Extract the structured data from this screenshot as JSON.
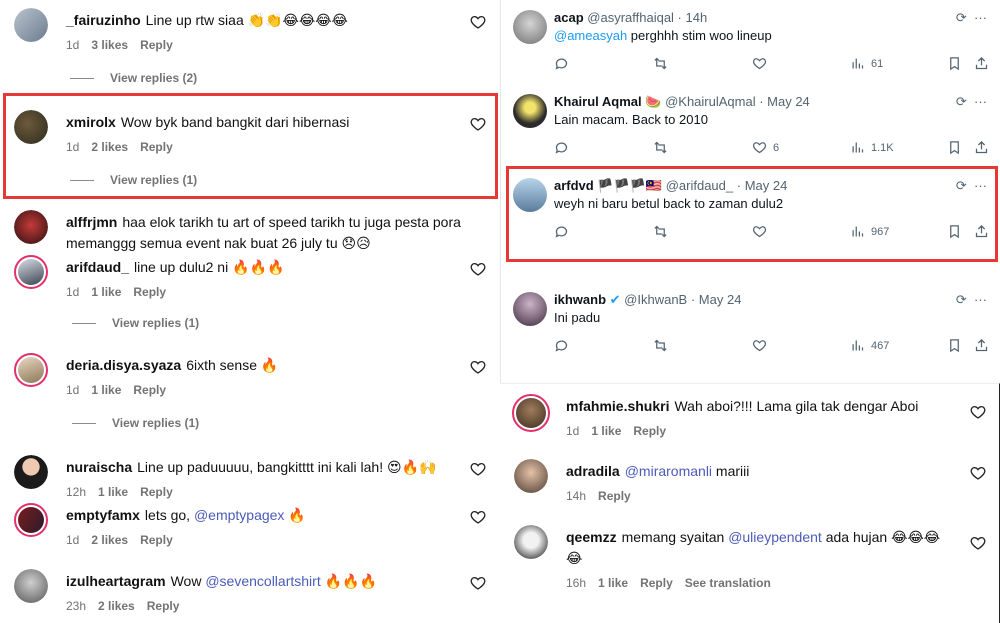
{
  "ig_left": [
    {
      "user": "_fairuzinho",
      "text": "Line up rtw siaa 👏👏😂😂😂😂",
      "time": "1d",
      "likes": "3 likes",
      "reply": "Reply",
      "replies": "View replies (2)"
    },
    {
      "user": "xmirolx",
      "text": "Wow byk band bangkit dari hibernasi",
      "time": "1d",
      "likes": "2 likes",
      "reply": "Reply",
      "replies": "View replies (1)"
    },
    {
      "user": "alffrjmn",
      "text": "haa elok tarikh tu art of speed tarikh tu juga pesta pora memanggg semua event nak buat 26 july tu 😞😥"
    },
    {
      "user": "arifdaud_",
      "text": "line up dulu2 ni 🔥🔥🔥",
      "time": "1d",
      "likes": "1 like",
      "reply": "Reply",
      "replies": "View replies (1)"
    },
    {
      "user": "deria.disya.syaza",
      "text": "6ixth sense 🔥",
      "time": "1d",
      "likes": "1 like",
      "reply": "Reply",
      "replies": "View replies (1)"
    },
    {
      "user": "nuraischa",
      "text": "Line up paduuuuu, bangkitttt ini kali lah! 😍🔥🙌",
      "time": "12h",
      "likes": "1 like",
      "reply": "Reply"
    },
    {
      "user": "emptyfamx",
      "text_before": "lets go, ",
      "mention": "@emptypagex",
      "text_after": " 🔥",
      "time": "1d",
      "likes": "2 likes",
      "reply": "Reply"
    },
    {
      "user": "izulheartagram",
      "text_before": "Wow ",
      "mention": "@sevencollartshirt",
      "text_after": " 🔥🔥🔥",
      "time": "23h",
      "likes": "2 likes",
      "reply": "Reply"
    }
  ],
  "tweets": [
    {
      "name": "acap",
      "handle": "@asyraffhaiqal",
      "time": "14h",
      "mention": "@ameasyah",
      "text": " perghhh stim woo lineup",
      "like": "",
      "retweet": "",
      "views": "61"
    },
    {
      "name": "Khairul Aqmal 🍉",
      "handle": "@KhairulAqmal",
      "time": "May 24",
      "text": "Lain macam. Back to 2010",
      "like": "6",
      "retweet": "",
      "views": "1.1K"
    },
    {
      "name": "arfdvd 🏴🏴🏴🇲🇾",
      "handle": "@arifdaud_",
      "time": "May 24",
      "text": "weyh ni baru betul back to zaman dulu2",
      "like": "",
      "retweet": "",
      "views": "967"
    },
    {
      "name": "ikhwanb",
      "handle": "@IkhwanB",
      "time": "May 24",
      "text": "Ini padu",
      "like": "",
      "retweet": "",
      "views": "467"
    }
  ],
  "ig_right": [
    {
      "user": "mfahmie.shukri",
      "text": "Wah aboi?!!! Lama gila tak dengar Aboi",
      "time": "1d",
      "likes": "1 like",
      "reply": "Reply"
    },
    {
      "user": "adradila",
      "mention": "@miraromanli",
      "text_after": " mariii",
      "time": "14h",
      "reply": "Reply"
    },
    {
      "user": "qeemzz",
      "text_before": "memang syaitan ",
      "mention": "@ulieypendent",
      "text_after": " ada hujan 😂😂😂 😂",
      "time": "16h",
      "likes": "1 like",
      "reply": "Reply",
      "translate": "See translation"
    }
  ],
  "colors": {
    "highlight": "#e53935",
    "ig_mention": "#4a5bb8",
    "tw_mention": "#1d9bf0",
    "muted": "#737373"
  }
}
